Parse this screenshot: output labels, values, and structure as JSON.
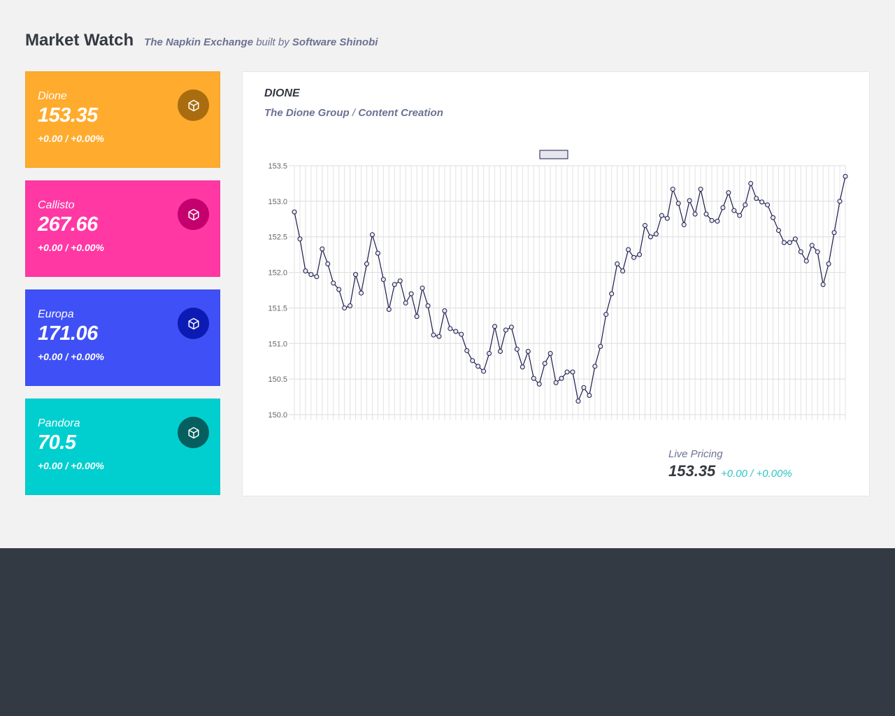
{
  "header": {
    "title": "Market Watch",
    "exchange": "The Napkin Exchange",
    "built_by": "built by",
    "author": "Software Shinobi"
  },
  "cards": [
    {
      "name": "Dione",
      "price": "153.35",
      "change": "+0.00 / +0.00%",
      "color": "#ffab2e",
      "icon_color": "#a96d10",
      "icon": "cube-icon"
    },
    {
      "name": "Callisto",
      "price": "267.66",
      "change": "+0.00 / +0.00%",
      "color": "#ff38a4",
      "icon_color": "#c4006e",
      "icon": "cube-icon"
    },
    {
      "name": "Europa",
      "price": "171.06",
      "change": "+0.00 / +0.00%",
      "color": "#3f50f6",
      "icon_color": "#0d1bb5",
      "icon": "cube-icon"
    },
    {
      "name": "Pandora",
      "price": "70.5",
      "change": "+0.00 / +0.00%",
      "color": "#01cfcf",
      "icon_color": "#065f5f",
      "icon": "cube-icon"
    }
  ],
  "panel": {
    "ticker": "DIONE",
    "company": "The Dione Group",
    "separator": "/",
    "sector": "Content Creation",
    "live_label": "Live Pricing",
    "live_price": "153.35",
    "live_change": "+0.00 / +0.00%"
  },
  "chart_data": {
    "type": "line",
    "title": "",
    "xlabel": "",
    "ylabel": "",
    "ylim": [
      150.0,
      153.5
    ],
    "yticks": [
      "153.5",
      "153.0",
      "152.5",
      "152.0",
      "151.5",
      "151.0",
      "150.5",
      "150.0"
    ],
    "grid": true,
    "line_color": "#1a1a4a",
    "series": [
      {
        "values": [
          152.85,
          152.47,
          152.02,
          151.97,
          151.94,
          152.33,
          152.12,
          151.85,
          151.76,
          151.5,
          151.53,
          151.97,
          151.71,
          152.12,
          152.53,
          152.27,
          151.9,
          151.48,
          151.83,
          151.88,
          151.57,
          151.7,
          151.38,
          151.78,
          151.53,
          151.12,
          151.1,
          151.46,
          151.21,
          151.17,
          151.13,
          150.9,
          150.76,
          150.68,
          150.61,
          150.86,
          151.24,
          150.89,
          151.19,
          151.23,
          150.92,
          150.67,
          150.89,
          150.51,
          150.43,
          150.72,
          150.86,
          150.45,
          150.51,
          150.6,
          150.6,
          150.19,
          150.38,
          150.27,
          150.68,
          150.96,
          151.41,
          151.7,
          152.12,
          152.02,
          152.32,
          152.21,
          152.25,
          152.66,
          152.5,
          152.54,
          152.8,
          152.76,
          153.17,
          152.97,
          152.67,
          153.01,
          152.82,
          153.17,
          152.82,
          152.73,
          152.72,
          152.91,
          153.12,
          152.87,
          152.8,
          152.95,
          153.25,
          153.04,
          152.99,
          152.95,
          152.77,
          152.59,
          152.42,
          152.42,
          152.47,
          152.29,
          152.16,
          152.38,
          152.29,
          151.83,
          152.12,
          152.56,
          153.0,
          153.35
        ]
      }
    ]
  }
}
